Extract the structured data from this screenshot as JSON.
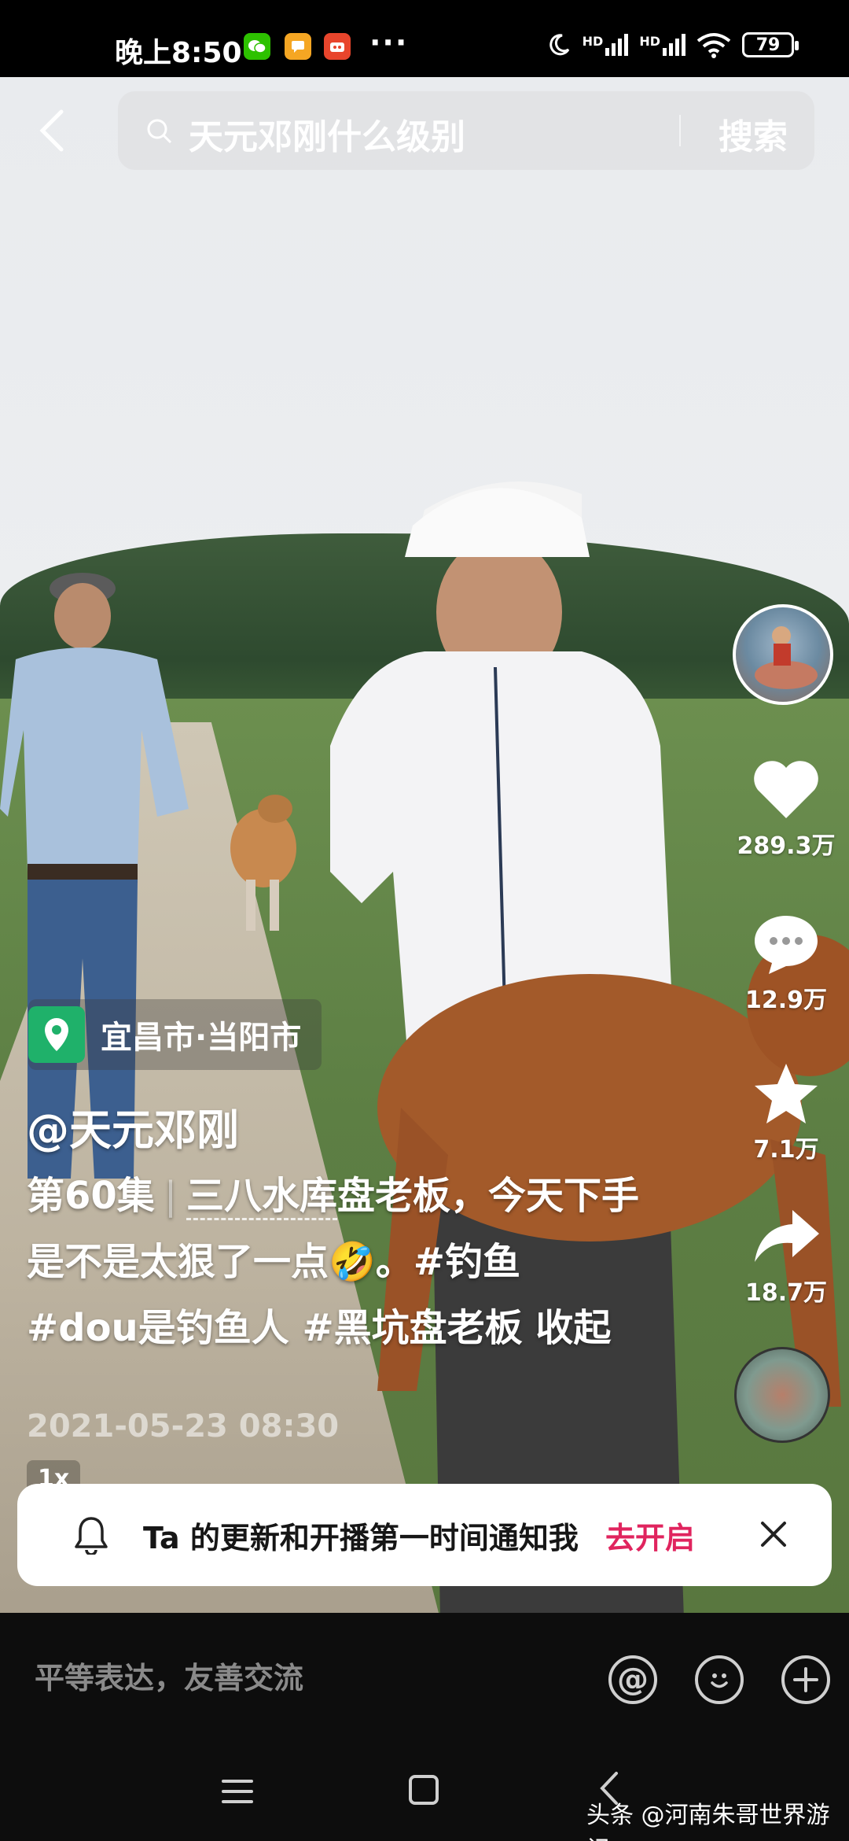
{
  "status_bar": {
    "time": "晚上8:50",
    "more": "···",
    "net_1": "HD",
    "net_2": "HD",
    "battery": "79"
  },
  "search": {
    "query": "天元邓刚什么级别",
    "button": "搜索"
  },
  "rail": {
    "likes": "289.3万",
    "comments": "12.9万",
    "favorites": "7.1万",
    "shares": "18.7万"
  },
  "location": "宜昌市·当阳市",
  "author": "@天元邓刚",
  "caption": {
    "episode": "第60集",
    "link": "三八水库",
    "text_1": "盘老板，今天下手是不是太狠了一点",
    "emoji": "🤣",
    "text_2": "。#钓鱼  #dou是钓鱼人 #黑坑盘老板",
    "collapse": "收起"
  },
  "date": "2021-05-23 08:30",
  "speed": "1x",
  "notification": {
    "text": "Ta 的更新和开播第一时间通知我",
    "action": "去开启"
  },
  "comment_bar": {
    "placeholder": "平等表达，友善交流",
    "at": "@"
  },
  "watermark": "头条 @河南朱哥世界游记",
  "colors": {
    "accent": "#e0245e",
    "location_icon": "#1fb16a"
  }
}
